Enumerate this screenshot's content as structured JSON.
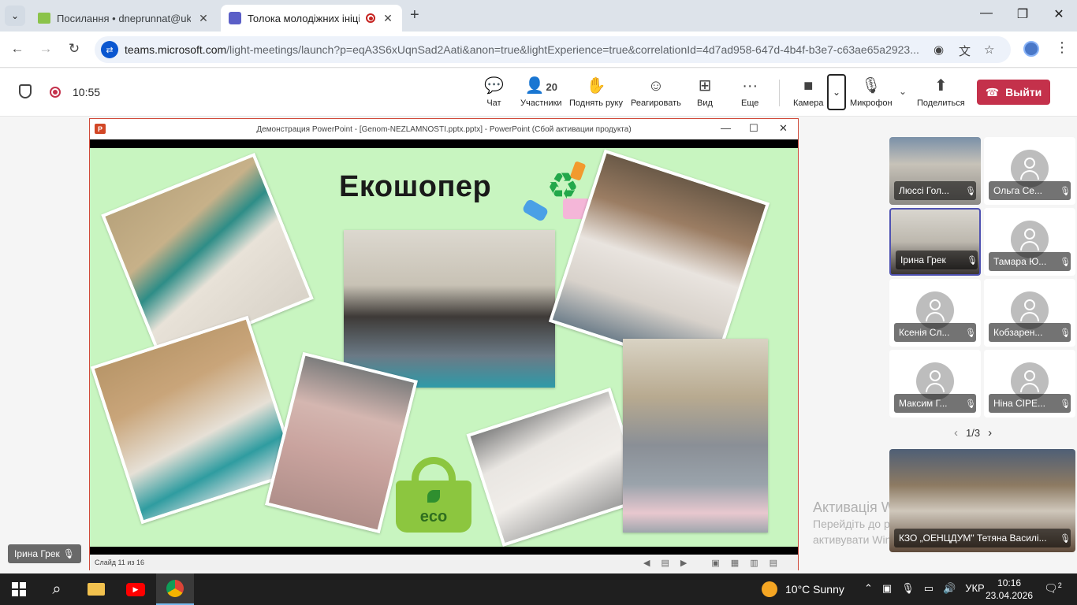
{
  "browser": {
    "tabs": [
      {
        "title": "Посилання • dneprunnat@ukr.",
        "active": false
      },
      {
        "title": "Толока молодіжних ініціат",
        "active": true
      }
    ],
    "url_host": "teams.microsoft.com",
    "url_path": "/light-meetings/launch?p=eqA3S6xUqnSad2Aati&anon=true&lightExperience=true&correlationId=4d7ad958-647d-4b4f-b3e7-c63ae65a2923..."
  },
  "meeting": {
    "timer": "10:55",
    "toolbar": {
      "chat": "Чат",
      "participants": "Участники",
      "participants_count": "20",
      "raise_hand": "Поднять руку",
      "react": "Реагировать",
      "view": "Вид",
      "more": "Еще",
      "camera": "Камера",
      "microphone": "Микрофон",
      "share": "Поделиться",
      "leave": "Выйти"
    },
    "powerpoint": {
      "window_title": "Демонстрация PowerPoint - [Genom-NEZLAMNOSTI.pptx.pptx] - PowerPoint (Сбой активации продукта)",
      "slide_title": "Екошопер",
      "status": "Слайд 11 из 16"
    },
    "participants": [
      {
        "name": "Люссі Гол...",
        "video": true
      },
      {
        "name": "Ольга Се...",
        "video": false
      },
      {
        "name": "Ірина Грек",
        "video": true,
        "speaking": true
      },
      {
        "name": "Тамара Ю...",
        "video": false
      },
      {
        "name": "Ксенія Сл...",
        "video": false
      },
      {
        "name": "Кобзарен...",
        "video": false
      },
      {
        "name": "Максим Г...",
        "video": false
      },
      {
        "name": "Ніна СІРЕ...",
        "video": false
      }
    ],
    "pager": "1/3",
    "big_tile_name": "КЗО „ОЕНЦДУМ\" Тетяна Василі...",
    "self_name": "Ірина Грек",
    "watermark": {
      "line1": "Активація Windows",
      "line2": "Перейдіть до розділу \"Настройки\", щоб",
      "line3": "активувати Windows."
    }
  },
  "taskbar": {
    "weather": "10°C  Sunny",
    "lang": "УКР",
    "time": "10:16",
    "date": "23.04.2026",
    "notifications": "2"
  },
  "colors": {
    "leave": "#c4314b",
    "slide_bg": "#c8f5c0",
    "speaker_border": "#4f52b2"
  }
}
